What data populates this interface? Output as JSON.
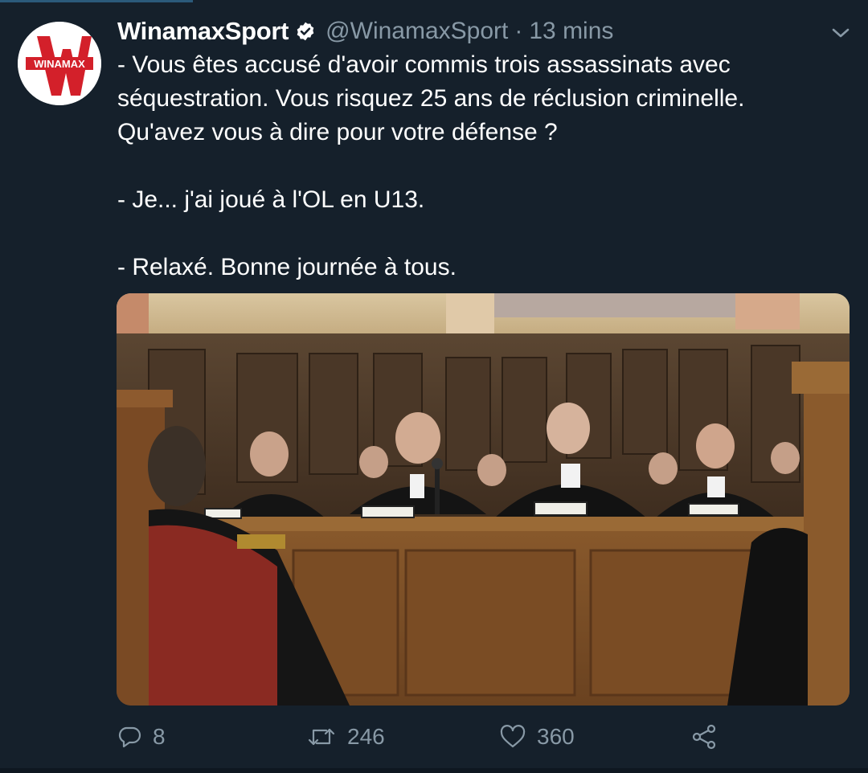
{
  "tweet": {
    "display_name": "WinamaxSport",
    "handle": "@WinamaxSport",
    "separator": "·",
    "time": "13 mins",
    "avatar_text": "WINAMAX",
    "text": "- Vous êtes accusé d'avoir commis trois assassinats avec\nséquestration. Vous risquez 25 ans de réclusion criminelle.\nQu'avez vous à dire pour votre défense ?\n\n- Je... j'ai joué à l'OL en U13.\n\n- Relaxé. Bonne journée à tous."
  },
  "actions": {
    "reply_count": "8",
    "retweet_count": "246",
    "like_count": "360"
  },
  "colors": {
    "background": "#15202b",
    "secondary_text": "#8899a6",
    "brand_red": "#d3202a"
  },
  "icons": [
    "verified-badge-icon",
    "chevron-down-icon",
    "reply-icon",
    "retweet-icon",
    "like-icon",
    "share-icon"
  ]
}
